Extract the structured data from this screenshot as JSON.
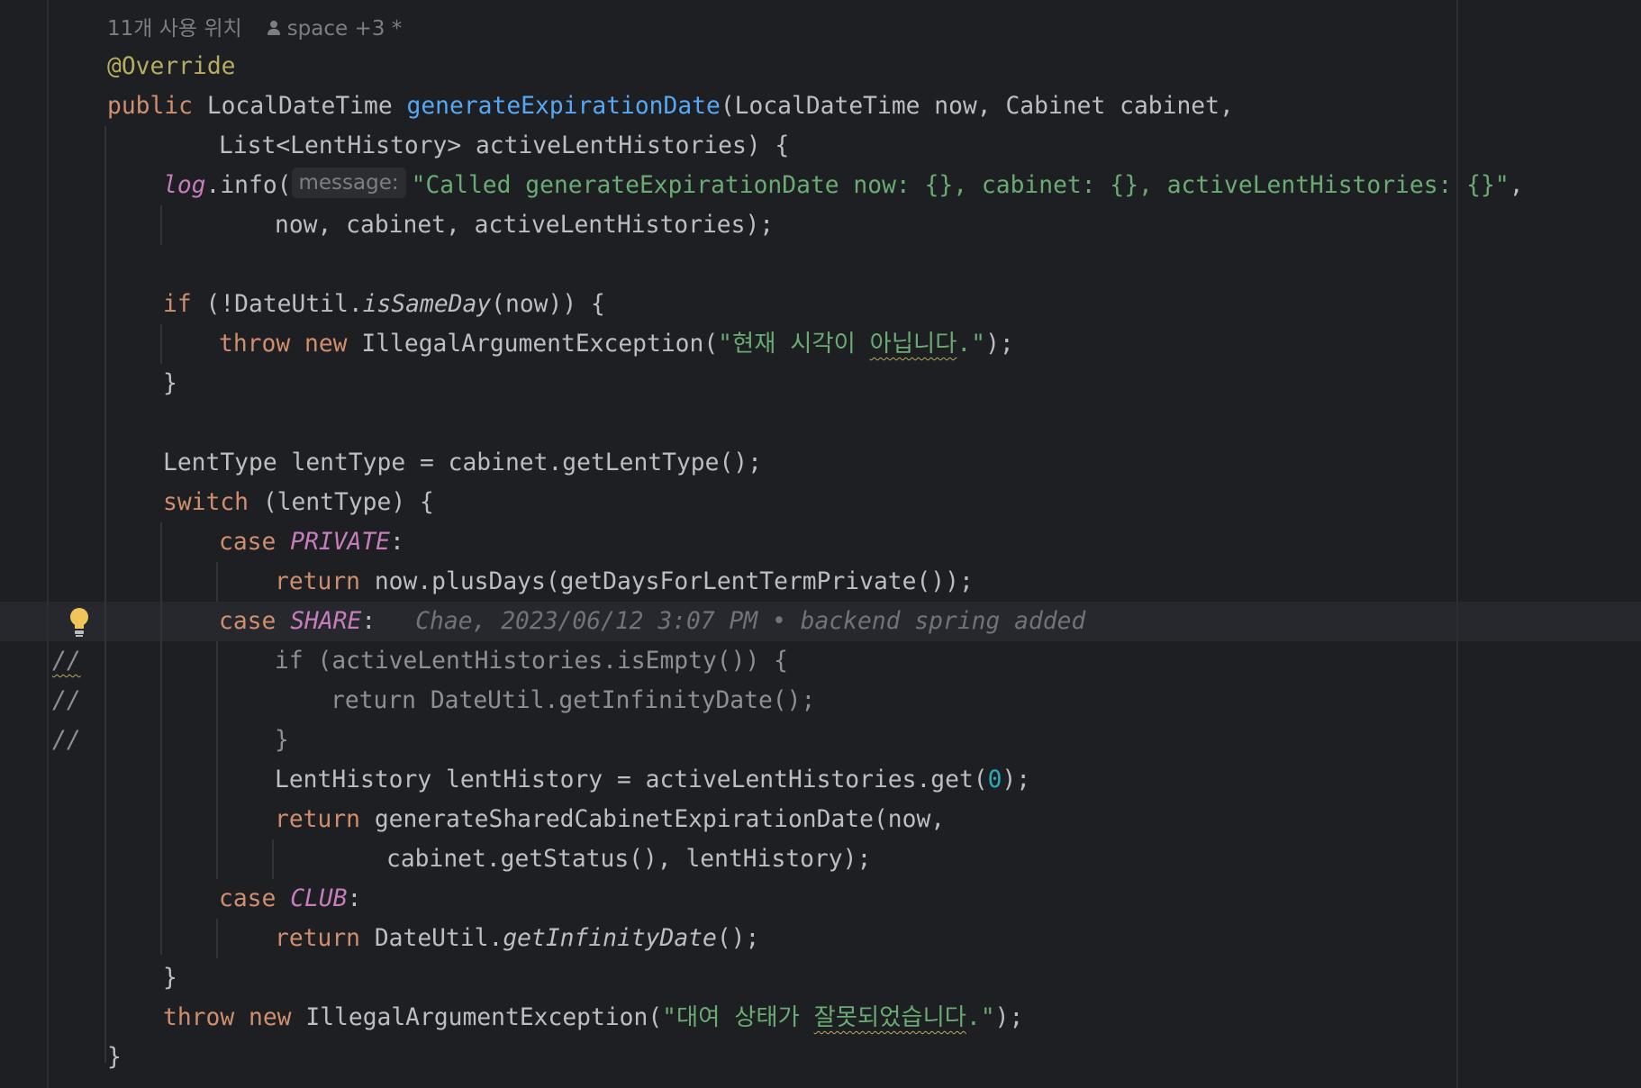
{
  "editor": {
    "usage_hint": {
      "usages": "11개 사용 위치",
      "authors": "space +3 *"
    },
    "code": {
      "annotation": "@Override",
      "sig_public": "public",
      "sig_return": "LocalDateTime",
      "method_name": "generateExpirationDate",
      "sig_params": "(LocalDateTime now, Cabinet cabinet,",
      "sig_params_cont": "List<LentHistory> activeLentHistories) {",
      "log_obj": "log",
      "log_call": ".info(",
      "param_hint": "message:",
      "log_msg": "\"Called generateExpirationDate now: {}, cabinet: {}, activeLentHistories: {}\"",
      "log_msg_end": ",",
      "log_args": "now, cabinet, activeLentHistories);",
      "if_kw": "if",
      "if_open": " (!DateUtil.",
      "is_same_day": "isSameDay",
      "if_close": "(now)) {",
      "throw_kw": "throw",
      "new_kw": "new",
      "iae_open": "IllegalArgumentException(",
      "err1_a": "\"현재 시각이 ",
      "err1_b": "아닙니다",
      "err1_c": ".\"",
      "close_paren_semi": ");",
      "close_brace": "}",
      "lenttype_decl": "LentType lentType = cabinet.getLentType();",
      "switch_kw": "switch",
      "switch_rest": " (lentType) {",
      "case_kw": "case",
      "case_private": "PRIVATE",
      "colon": ":",
      "return_kw": "return",
      "return_private": "now.plusDays(getDaysForLentTermPrivate());",
      "case_share": "SHARE",
      "blame": "Chae, 2023/06/12 3:07 PM • backend spring added",
      "cm_if": "if (activeLentHistories.isEmpty()) {",
      "cm_return": "return DateUtil.getInfinityDate();",
      "cm_close": "}",
      "comment_marker": "//",
      "lh_decl_a": "LentHistory lentHistory = activeLentHistories.get(",
      "lh_index": "0",
      "lh_decl_b": ");",
      "return_shared_a": "generateSharedCabinetExpirationDate(now,",
      "return_shared_b": "cabinet.getStatus(), lentHistory);",
      "case_club": "CLUB",
      "return_club_a": "DateUtil.",
      "get_infinity": "getInfinityDate",
      "return_club_b": "();",
      "err2_a": "\"대여 상태가 ",
      "err2_b": "잘못되었습니다",
      "err2_c": ".\""
    }
  },
  "colors": {
    "background": "#1e1f22",
    "keyword": "#cf8e6d",
    "string": "#6aab73",
    "method_declaration": "#56a8f5",
    "annotation": "#b3ae60",
    "enum_constant": "#c77dbb",
    "number": "#2aacb8",
    "text": "#bcbec4"
  },
  "icons": {
    "author": "person-icon",
    "intention": "lightbulb-icon"
  }
}
